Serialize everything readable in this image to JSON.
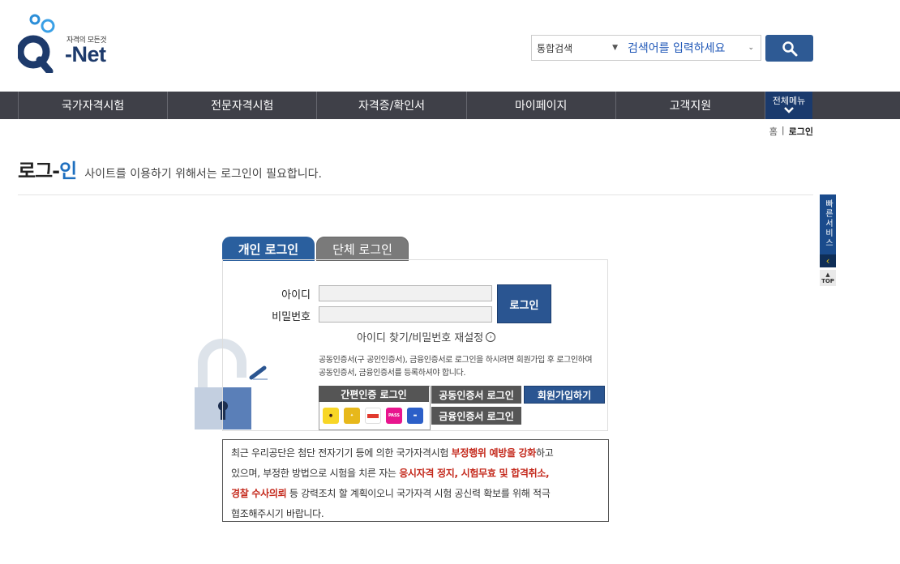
{
  "header": {
    "logo_tagline": "자격의 모든것",
    "logo_text": "-Net",
    "logo_letter": "Q",
    "search": {
      "scope": "통합검색",
      "placeholder": "검색어를 입력하세요"
    }
  },
  "nav": {
    "items": [
      {
        "label": "국가자격시험"
      },
      {
        "label": "전문자격시험"
      },
      {
        "label": "자격증/확인서"
      },
      {
        "label": "마이페이지"
      },
      {
        "label": "고객지원"
      }
    ],
    "all_menu": "전체메뉴"
  },
  "breadcrumb": {
    "home": "홈",
    "sep": "|",
    "current": "로그인"
  },
  "page": {
    "title_a": "로그",
    "title_dash": "-",
    "title_b": "인",
    "subtitle": "사이트를 이용하기 위해서는 로그인이 필요합니다."
  },
  "quick": {
    "label": "빠른서비스",
    "top": "TOP"
  },
  "login": {
    "tab_personal": "개인 로그인",
    "tab_group": "단체 로그인",
    "id_label": "아이디",
    "pw_label": "비밀번호",
    "login_button": "로그인",
    "find_link": "아이디 찾기/비밀번호 재설정",
    "cert_notice": "공동인증서(구 공인인증서), 금융인증서로 로그인을 하시려면 회원가입 후 로그인하여 공동인증서, 금융인증서를 등록하셔야 합니다.",
    "simple_auth": "간편인증 로그인",
    "joint_cert": "공동인증서 로그인",
    "join": "회원가입하기",
    "finance_cert": "금융인증서 로그인",
    "providers": [
      "kakao",
      "toss",
      "payco",
      "PASS",
      "Naver"
    ]
  },
  "warning": {
    "l1a": "최근 우리공단은 첨단 전자기기 등에 의한 국가자격시험 ",
    "l1b": "부정행위 예방을 강화",
    "l1c": "하고",
    "l2a": "있으며, 부정한 방법으로 시험을 치른 자는 ",
    "l2b": "응시자격 정지, 시험무효 및 합격취소,",
    "l3a": "경찰 수사의뢰",
    "l3b": " 등 강력조치 할 계획이오니 국가자격 시험 공신력 확보를 위해 적극",
    "l4": "협조해주시기 바랍니다."
  },
  "colors": {
    "nav_bg": "#3f4048",
    "brand_blue": "#2a5591",
    "alert_red": "#c4291c"
  }
}
